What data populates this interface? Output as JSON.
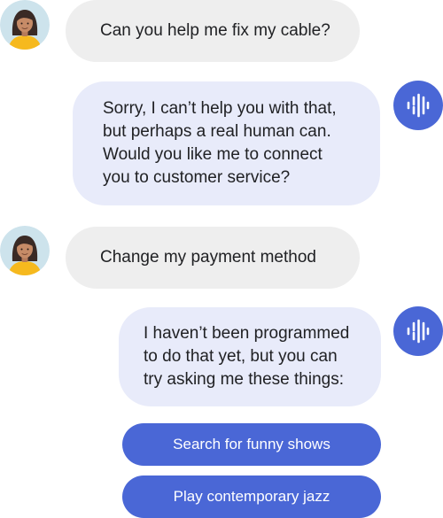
{
  "colors": {
    "user_bubble": "#eeeeee",
    "assistant_bubble": "#e8ebfa",
    "accent": "#4a67d6",
    "chip_text": "#ffffff"
  },
  "conversation": {
    "messages": [
      {
        "role": "user",
        "avatar_icon": "user-avatar",
        "text": "Can you help me fix my cable?"
      },
      {
        "role": "assistant",
        "avatar_icon": "voice-waveform-icon",
        "text": "Sorry,  I can’t help you with that,\nbut perhaps a real human can.\nWould you like me to connect\nyou to customer service?"
      },
      {
        "role": "user",
        "avatar_icon": "user-avatar",
        "text": "Change my payment method"
      },
      {
        "role": "assistant",
        "avatar_icon": "voice-waveform-icon",
        "text": "I haven’t been programmed\nto do that yet, but you can\ntry asking me these things:"
      }
    ],
    "suggestions": [
      {
        "label": "Search for funny shows"
      },
      {
        "label": "Play contemporary jazz"
      }
    ]
  }
}
